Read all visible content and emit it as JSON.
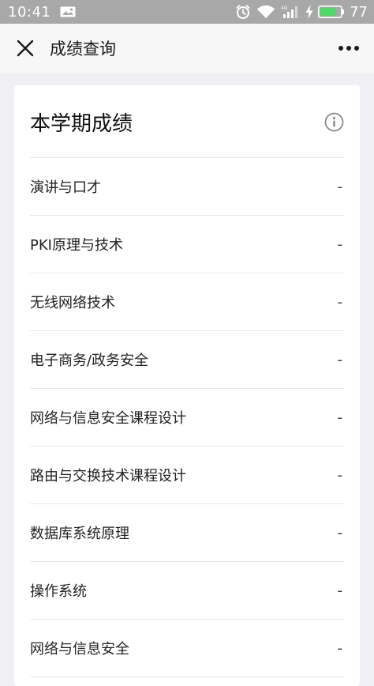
{
  "status_bar": {
    "time": "10:41",
    "battery_level": "77",
    "icons": [
      "image-icon",
      "alarm-icon",
      "wifi-icon",
      "signal-icon",
      "charging-icon",
      "battery-icon"
    ]
  },
  "navbar": {
    "title": "成绩查询",
    "close_icon": "close-icon",
    "more_icon": "more-icon"
  },
  "card": {
    "title": "本学期成绩",
    "info_icon": "info-icon"
  },
  "courses": [
    {
      "name": "演讲与口才",
      "score": "-"
    },
    {
      "name": "PKI原理与技术",
      "score": "-"
    },
    {
      "name": "无线网络技术",
      "score": "-"
    },
    {
      "name": "电子商务/政务安全",
      "score": "-"
    },
    {
      "name": "网络与信息安全课程设计",
      "score": "-"
    },
    {
      "name": "路由与交换技术课程设计",
      "score": "-"
    },
    {
      "name": "数据库系统原理",
      "score": "-"
    },
    {
      "name": "操作系统",
      "score": "-"
    },
    {
      "name": "网络与信息安全",
      "score": "-"
    }
  ],
  "colors": {
    "status_bar": "#a8a8a8",
    "navbar": "#f7f7f7",
    "page_background": "#efeff4",
    "card": "#ffffff",
    "battery_fill": "#4cd964"
  }
}
